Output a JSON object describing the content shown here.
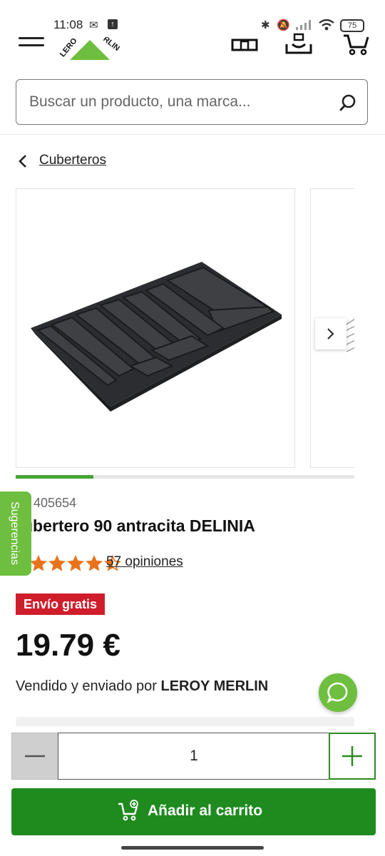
{
  "status_bar": {
    "time": "11:08",
    "battery": "75"
  },
  "search": {
    "placeholder": "Buscar un producto, una marca..."
  },
  "breadcrumb": {
    "label": "Cuberteros"
  },
  "product": {
    "ref": "f. 405654",
    "title": "ubertero 90 antracita DELINIA",
    "rating": 4.5,
    "reviews": "57 opiniones",
    "badge": "Envío gratis",
    "price": "19.79 €",
    "seller_prefix": "Vendido y enviado por",
    "seller_name": "LEROY MERLIN",
    "gallery_progress": 0.23
  },
  "suggestions_tab": {
    "label": "Sugerencias"
  },
  "quantity": {
    "value": "1"
  },
  "cta": {
    "add_to_cart": "Añadir al carrito"
  },
  "colors": {
    "brand_green": "#6ebe3f",
    "cta_green": "#1f8b1f",
    "badge_red": "#d01d2b",
    "star_orange": "#e8731c"
  },
  "icons": [
    "menu-icon",
    "store-icon",
    "delivery-icon",
    "cart-icon",
    "search-icon",
    "chevron-left-icon",
    "chevron-right-icon",
    "star-icon",
    "chat-icon",
    "minus-icon",
    "plus-icon",
    "add-cart-icon"
  ]
}
